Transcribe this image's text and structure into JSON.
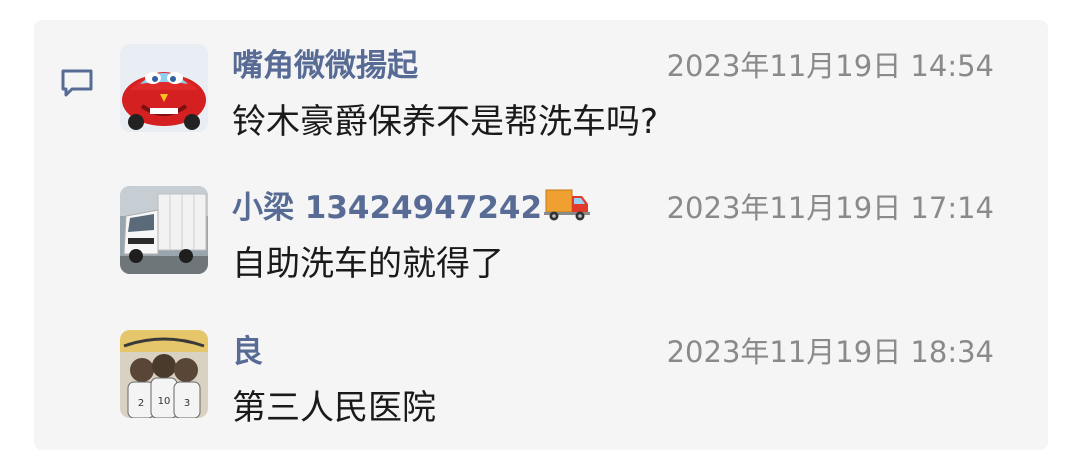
{
  "comments": [
    {
      "name": "嘴角微微揚起",
      "time": "2023年11月19日 14:54",
      "text": "铃木豪爵保养不是帮洗车吗?",
      "avatar": "red-race-car-avatar"
    },
    {
      "name": "小梁 13424947242",
      "time": "2023年11月19日 17:14",
      "text": "自助洗车的就得了",
      "avatar": "white-truck-avatar",
      "emoji": "delivery-truck-icon"
    },
    {
      "name": "良",
      "time": "2023年11月19日 18:34",
      "text": "第三人民医院",
      "avatar": "cartoon-team-avatar"
    }
  ],
  "colors": {
    "name": "#576b95",
    "time": "#8a8a8a",
    "text": "#1a1a1a",
    "panel": "#f5f5f5",
    "icon": "#576b95"
  }
}
